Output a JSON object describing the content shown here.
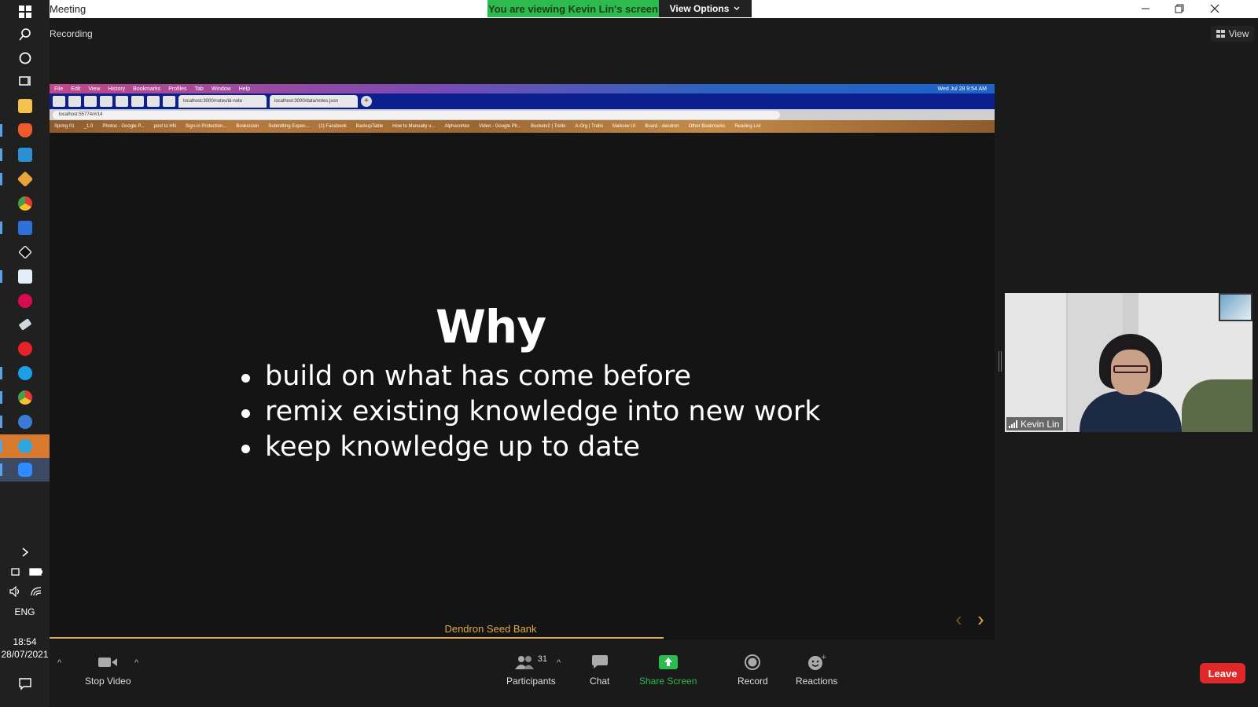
{
  "taskbar": {
    "language": "ENG",
    "time": "18:54",
    "date": "28/07/2021",
    "show_hidden_label": ">"
  },
  "window": {
    "title": "Meeting",
    "viewing_banner": "You are viewing Kevin Lin's screen",
    "view_options": "View Options",
    "recording": "Recording",
    "view_button": "View"
  },
  "shared_screen": {
    "browser": {
      "menu": [
        "File",
        "Edit",
        "View",
        "History",
        "Bookmarks",
        "Profiles",
        "Tab",
        "Window",
        "Help"
      ],
      "clock": "Wed Jul 28 9:54 AM",
      "tabs": [
        "localhost:3000/notes/id-note",
        "localhost:3000/data/notes.json"
      ],
      "address": "localhost:55774/#/14",
      "bookmarks": [
        "Spring 01",
        "_1.0",
        "Photos - Google P...",
        "post to HN",
        "Sign-in Protection...",
        "Bookcision",
        "Submitting Expen...",
        "(1) Facebook",
        "BackupTable",
        "How to Manually u...",
        "Alphacortex",
        "Video - Google Ph...",
        "Bucketv2 | Trello",
        "A-Org | Trello",
        "Mailcow UI",
        "Board - dendron",
        "Other Bookmarks",
        "Reading List"
      ]
    },
    "slide": {
      "title": "Why",
      "bullets": [
        "build on what has come before",
        "remix existing knowledge into new work",
        "keep knowledge up to date"
      ],
      "footer": "Dendron Seed Bank",
      "progress": 0.65
    }
  },
  "participant": {
    "name": "Kevin Lin"
  },
  "toolbar": {
    "stop_video": "Stop Video",
    "participants": "Participants",
    "participants_count": "31",
    "chat": "Chat",
    "share_screen": "Share Screen",
    "record": "Record",
    "reactions": "Reactions",
    "leave": "Leave"
  },
  "colors": {
    "banner_green": "#2dba4e",
    "slide_accent": "#e0a94a",
    "leave_red": "#e02828",
    "share_green": "#2dba4e"
  }
}
